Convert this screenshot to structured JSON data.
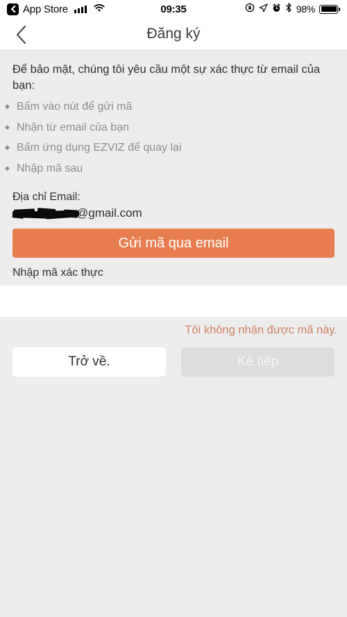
{
  "status_bar": {
    "back_label": "App Store",
    "back_icon": "chevron-left-icon",
    "signal_icon": "cellular-signal-icon",
    "wifi_icon": "wifi-icon",
    "time": "09:35",
    "rotation_lock_icon": "rotation-lock-icon",
    "location_icon": "location-arrow-icon",
    "alarm_icon": "alarm-clock-icon",
    "bluetooth_icon": "bluetooth-icon",
    "battery_percent": "98%",
    "battery_icon": "battery-icon"
  },
  "nav": {
    "back_icon": "chevron-left-icon",
    "title": "Đăng ký"
  },
  "main": {
    "intro": "Để bảo mật, chúng tôi yêu cầu một sự xác thực từ email của bạn:",
    "steps": [
      "Bấm vào nút để gửi mã",
      "Nhận từ email của bạn",
      "Bấm ứng dụng EZVIZ để quay lại",
      "Nhập mã sau"
    ],
    "email_label": "Địa chỉ Email:",
    "email_domain": "@gmail.com",
    "send_button": "Gửi mã qua email",
    "code_label": "Nhập mã xác thực",
    "code_value": "",
    "code_placeholder": "",
    "resend_link": "Tôi không nhận được mã này.",
    "back_button": "Trở về.",
    "next_button": "Kế tiếp"
  },
  "colors": {
    "accent_orange": "#e87e50",
    "link_orange": "#d08060",
    "background": "#ededed",
    "disabled": "#dcdcdc"
  }
}
